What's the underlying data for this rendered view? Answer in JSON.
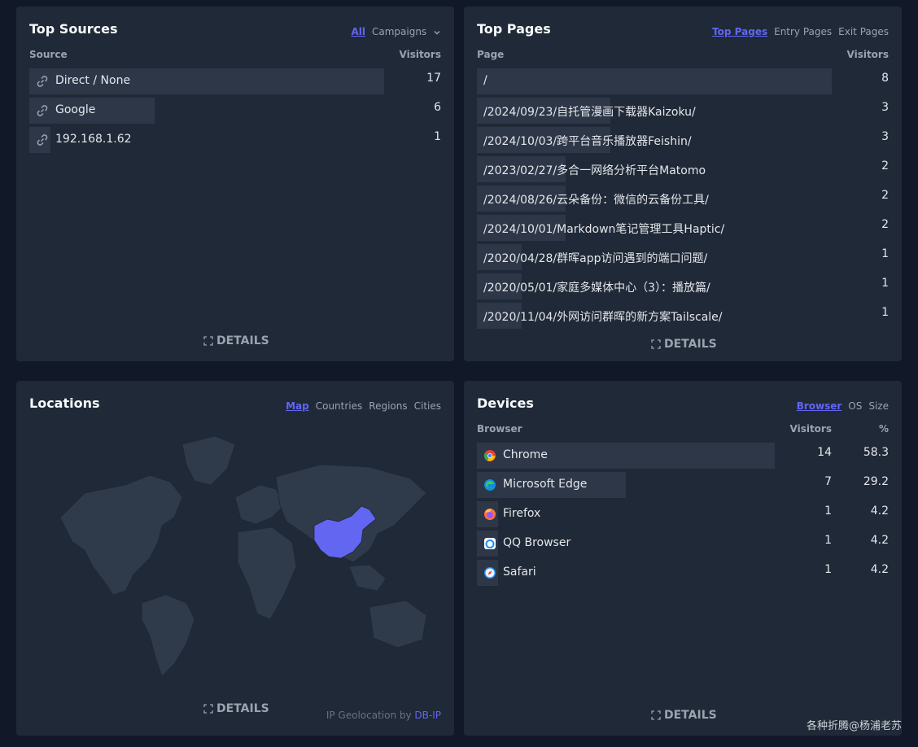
{
  "top_sources": {
    "title": "Top Sources",
    "tabs": [
      "All",
      "Campaigns"
    ],
    "col_source": "Source",
    "col_visitors": "Visitors",
    "rows": [
      {
        "label": "Direct / None",
        "value": "17",
        "fraction": 1.0
      },
      {
        "label": "Google",
        "value": "6",
        "fraction": 0.353
      },
      {
        "label": "192.168.1.62",
        "value": "1",
        "fraction": 0.059
      }
    ],
    "details": "DETAILS"
  },
  "top_pages": {
    "title": "Top Pages",
    "tabs": [
      "Top Pages",
      "Entry Pages",
      "Exit Pages"
    ],
    "col_page": "Page",
    "col_visitors": "Visitors",
    "rows": [
      {
        "label": "/",
        "value": "8",
        "fraction": 1.0
      },
      {
        "label": "/2024/09/23/自托管漫画下载器Kaizoku/",
        "value": "3",
        "fraction": 0.375
      },
      {
        "label": "/2024/10/03/跨平台音乐播放器Feishin/",
        "value": "3",
        "fraction": 0.375
      },
      {
        "label": "/2023/02/27/多合一网络分析平台Matomo",
        "value": "2",
        "fraction": 0.25
      },
      {
        "label": "/2024/08/26/云朵备份：微信的云备份工具/",
        "value": "2",
        "fraction": 0.25
      },
      {
        "label": "/2024/10/01/Markdown笔记管理工具Haptic/",
        "value": "2",
        "fraction": 0.25
      },
      {
        "label": "/2020/04/28/群晖app访问遇到的端口问题/",
        "value": "1",
        "fraction": 0.125
      },
      {
        "label": "/2020/05/01/家庭多媒体中心（3）：播放篇/",
        "value": "1",
        "fraction": 0.125
      },
      {
        "label": "/2020/11/04/外网访问群晖的新方案Tailscale/",
        "value": "1",
        "fraction": 0.125
      }
    ],
    "details": "DETAILS"
  },
  "locations": {
    "title": "Locations",
    "tabs": [
      "Map",
      "Countries",
      "Regions",
      "Cities"
    ],
    "details": "DETAILS",
    "geo_note": "IP Geolocation by",
    "geo_link": "DB-IP",
    "highlight_color": "#6366f1",
    "land_color": "#374151"
  },
  "devices": {
    "title": "Devices",
    "tabs": [
      "Browser",
      "OS",
      "Size"
    ],
    "col_browser": "Browser",
    "col_visitors": "Visitors",
    "col_pct": "%",
    "rows": [
      {
        "label": "Chrome",
        "icon": "chrome-icon",
        "value": "14",
        "pct": "58.3",
        "fraction": 1.0
      },
      {
        "label": "Microsoft Edge",
        "icon": "edge-icon",
        "value": "7",
        "pct": "29.2",
        "fraction": 0.5
      },
      {
        "label": "Firefox",
        "icon": "firefox-icon",
        "value": "1",
        "pct": "4.2",
        "fraction": 0.072
      },
      {
        "label": "QQ Browser",
        "icon": "qq-browser-icon",
        "value": "1",
        "pct": "4.2",
        "fraction": 0.072
      },
      {
        "label": "Safari",
        "icon": "safari-icon",
        "value": "1",
        "pct": "4.2",
        "fraction": 0.072
      }
    ],
    "details": "DETAILS"
  },
  "watermark": "各种折腾@杨浦老苏"
}
